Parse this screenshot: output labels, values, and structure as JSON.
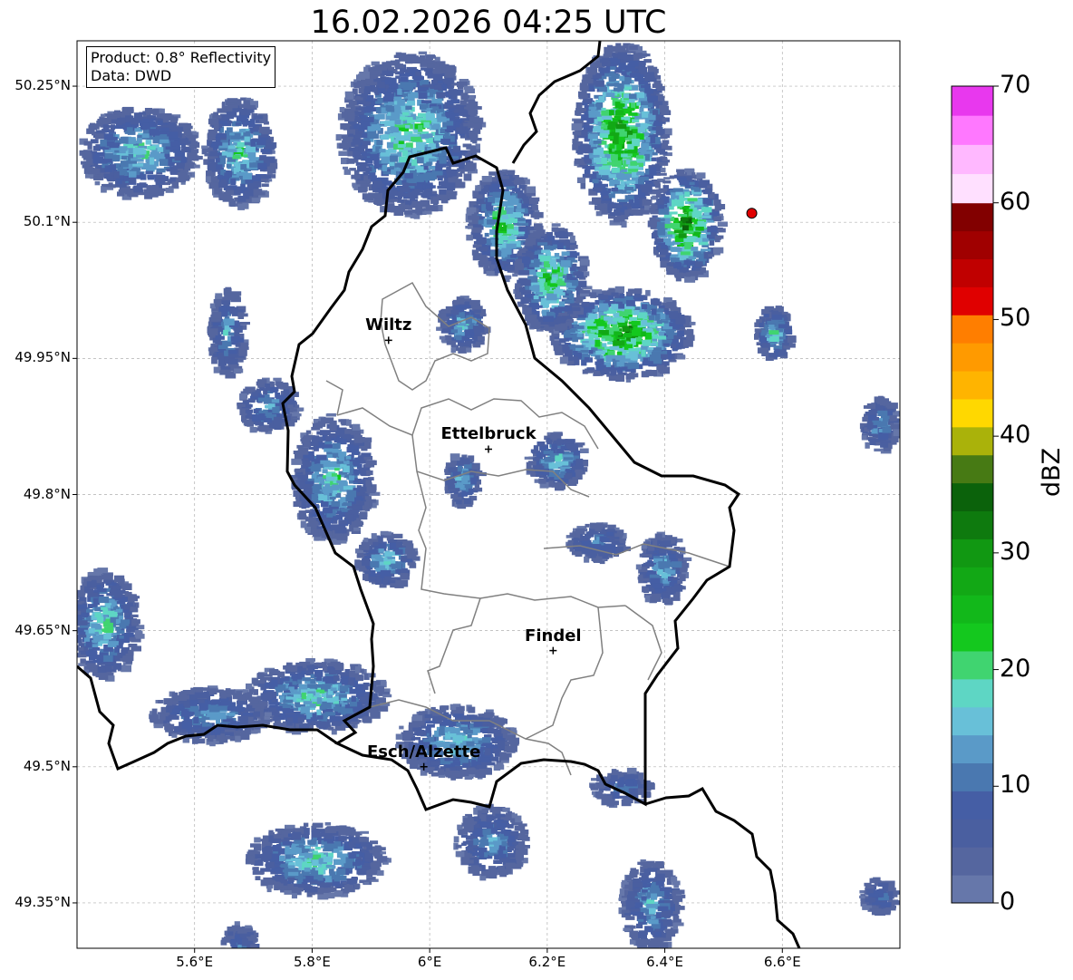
{
  "title": "16.02.2026 04:25 UTC",
  "infobox": {
    "product": "Product: 0.8° Reflectivity",
    "data": "Data: DWD"
  },
  "map": {
    "lon_range": [
      5.4,
      6.8
    ],
    "lat_range": [
      49.3,
      50.3
    ],
    "grid": true,
    "lat_ticks": [
      {
        "value": 50.25,
        "label": "50.25°N"
      },
      {
        "value": 50.1,
        "label": "50.1°N"
      },
      {
        "value": 49.95,
        "label": "49.95°N"
      },
      {
        "value": 49.8,
        "label": "49.8°N"
      },
      {
        "value": 49.65,
        "label": "49.65°N"
      },
      {
        "value": 49.5,
        "label": "49.5°N"
      },
      {
        "value": 49.35,
        "label": "49.35°N"
      }
    ],
    "lon_ticks": [
      {
        "value": 5.6,
        "label": "5.6°E"
      },
      {
        "value": 5.8,
        "label": "5.8°E"
      },
      {
        "value": 6.0,
        "label": "6°E"
      },
      {
        "value": 6.2,
        "label": "6.2°E"
      },
      {
        "value": 6.4,
        "label": "6.4°E"
      },
      {
        "value": 6.6,
        "label": "6.6°E"
      }
    ],
    "cities": [
      {
        "name": "Wiltz",
        "lon": 5.93,
        "lat": 49.97
      },
      {
        "name": "Ettelbruck",
        "lon": 6.1,
        "lat": 49.85
      },
      {
        "name": "Findel",
        "lon": 6.21,
        "lat": 49.628
      },
      {
        "name": "Esch/Alzette",
        "lon": 5.99,
        "lat": 49.5
      }
    ],
    "radar_site": {
      "lon": 6.548,
      "lat": 50.11,
      "color": "#e00000"
    },
    "border_color": "#000000",
    "canton_color": "#808080"
  },
  "colorbar": {
    "label": "dBZ",
    "min": 0,
    "max": 70,
    "ticks": [
      "0",
      "10",
      "20",
      "30",
      "40",
      "50",
      "60",
      "70"
    ],
    "colors": [
      "#6677aa",
      "#55669f",
      "#4a5fa0",
      "#455ea5",
      "#4a78b0",
      "#5a9ac8",
      "#68c0d8",
      "#5ed6c4",
      "#40d470",
      "#14c81e",
      "#12b81a",
      "#12a815",
      "#119812",
      "#0e7a0e",
      "#0b620b",
      "#477a14",
      "#aab20a",
      "#ffd800",
      "#ffb400",
      "#ff9a00",
      "#ff7e00",
      "#e00000",
      "#c00000",
      "#a00000",
      "#820000",
      "#ffe0ff",
      "#ffb8ff",
      "#ff78ff",
      "#e838ee"
    ]
  },
  "echo_clusters": [
    {
      "lon": 5.5,
      "lat": 50.18,
      "rlon": 0.1,
      "rlat": 0.05,
      "peak": 24
    },
    {
      "lon": 5.67,
      "lat": 50.18,
      "rlon": 0.06,
      "rlat": 0.06,
      "peak": 24
    },
    {
      "lon": 5.65,
      "lat": 49.98,
      "rlon": 0.03,
      "rlat": 0.05,
      "peak": 18
    },
    {
      "lon": 5.72,
      "lat": 49.9,
      "rlon": 0.05,
      "rlat": 0.03,
      "peak": 18
    },
    {
      "lon": 5.96,
      "lat": 50.2,
      "rlon": 0.12,
      "rlat": 0.09,
      "peak": 26
    },
    {
      "lon": 6.12,
      "lat": 50.1,
      "rlon": 0.06,
      "rlat": 0.06,
      "peak": 28
    },
    {
      "lon": 6.05,
      "lat": 49.99,
      "rlon": 0.04,
      "rlat": 0.03,
      "peak": 20
    },
    {
      "lon": 6.32,
      "lat": 50.2,
      "rlon": 0.08,
      "rlat": 0.1,
      "peak": 36
    },
    {
      "lon": 6.43,
      "lat": 50.1,
      "rlon": 0.06,
      "rlat": 0.06,
      "peak": 41
    },
    {
      "lon": 6.32,
      "lat": 49.98,
      "rlon": 0.12,
      "rlat": 0.05,
      "peak": 39
    },
    {
      "lon": 6.2,
      "lat": 50.04,
      "rlon": 0.06,
      "rlat": 0.06,
      "peak": 30
    },
    {
      "lon": 6.58,
      "lat": 49.98,
      "rlon": 0.03,
      "rlat": 0.03,
      "peak": 24
    },
    {
      "lon": 6.21,
      "lat": 49.84,
      "rlon": 0.05,
      "rlat": 0.03,
      "peak": 22
    },
    {
      "lon": 5.83,
      "lat": 49.82,
      "rlon": 0.07,
      "rlat": 0.07,
      "peak": 24
    },
    {
      "lon": 5.92,
      "lat": 49.73,
      "rlon": 0.05,
      "rlat": 0.03,
      "peak": 22
    },
    {
      "lon": 6.05,
      "lat": 49.82,
      "rlon": 0.03,
      "rlat": 0.03,
      "peak": 20
    },
    {
      "lon": 6.39,
      "lat": 49.72,
      "rlon": 0.04,
      "rlat": 0.04,
      "peak": 20
    },
    {
      "lon": 6.28,
      "lat": 49.75,
      "rlon": 0.05,
      "rlat": 0.02,
      "peak": 16
    },
    {
      "lon": 5.44,
      "lat": 49.66,
      "rlon": 0.06,
      "rlat": 0.06,
      "peak": 24
    },
    {
      "lon": 5.8,
      "lat": 49.58,
      "rlon": 0.12,
      "rlat": 0.04,
      "peak": 24
    },
    {
      "lon": 5.62,
      "lat": 49.56,
      "rlon": 0.1,
      "rlat": 0.03,
      "peak": 18
    },
    {
      "lon": 6.04,
      "lat": 49.53,
      "rlon": 0.1,
      "rlat": 0.04,
      "peak": 22
    },
    {
      "lon": 5.8,
      "lat": 49.4,
      "rlon": 0.12,
      "rlat": 0.04,
      "peak": 24
    },
    {
      "lon": 6.1,
      "lat": 49.42,
      "rlon": 0.06,
      "rlat": 0.04,
      "peak": 18
    },
    {
      "lon": 6.37,
      "lat": 49.35,
      "rlon": 0.05,
      "rlat": 0.05,
      "peak": 20
    },
    {
      "lon": 5.67,
      "lat": 49.3,
      "rlon": 0.03,
      "rlat": 0.03,
      "peak": 16
    },
    {
      "lon": 6.76,
      "lat": 49.88,
      "rlon": 0.03,
      "rlat": 0.03,
      "peak": 18
    },
    {
      "lon": 6.76,
      "lat": 49.36,
      "rlon": 0.03,
      "rlat": 0.02,
      "peak": 14
    },
    {
      "lon": 6.32,
      "lat": 49.48,
      "rlon": 0.05,
      "rlat": 0.02,
      "peak": 14
    }
  ]
}
